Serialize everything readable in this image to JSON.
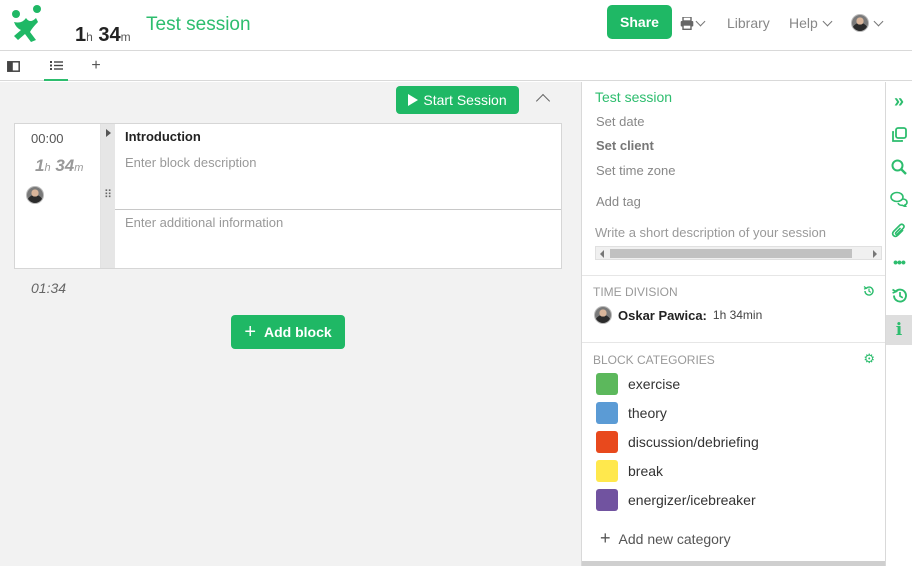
{
  "header": {
    "total_hours": "1",
    "hours_unit": "h",
    "total_minutes": "34",
    "minutes_unit": "m",
    "session_title": "Test session",
    "share_label": "Share",
    "library_label": "Library",
    "help_label": "Help"
  },
  "tabs": [
    {
      "icon": "columns-icon"
    },
    {
      "icon": "list-icon",
      "active": true
    },
    {
      "icon": "plus-icon"
    }
  ],
  "toolbar": {
    "start_session_label": "Start Session"
  },
  "block": {
    "start_time": "00:00",
    "dur_hours": "1",
    "dur_hours_unit": "h",
    "dur_minutes": "34",
    "dur_minutes_unit": "m",
    "title": "Introduction",
    "description_placeholder": "Enter block description",
    "additional_placeholder": "Enter additional information"
  },
  "total_time": "01:34",
  "add_block_label": "Add block",
  "panel": {
    "title": "Test session",
    "set_date": "Set date",
    "set_client": "Set client",
    "set_time_zone": "Set time zone",
    "add_tag": "Add tag",
    "description_placeholder": "Write a short description of your session",
    "time_division_header": "Time division",
    "time_division": {
      "name": "Oskar Pawica:",
      "duration": "1h 34min"
    },
    "block_categories_header": "Block categories",
    "categories": [
      {
        "label": "exercise",
        "color": "#5cb85c"
      },
      {
        "label": "theory",
        "color": "#5b9bd5"
      },
      {
        "label": "discussion/debriefing",
        "color": "#e8491d"
      },
      {
        "label": "break",
        "color": "#ffe84d"
      },
      {
        "label": "energizer/icebreaker",
        "color": "#7153a0"
      }
    ],
    "add_category_label": "Add new category"
  },
  "rail": [
    "expand-icon",
    "copy-icon",
    "search-icon",
    "comments-icon",
    "paperclip-icon",
    "more-icon",
    "history-icon",
    "info-icon"
  ],
  "colors": {
    "accent": "#1fb865",
    "accent_text": "#2dbd6e"
  }
}
